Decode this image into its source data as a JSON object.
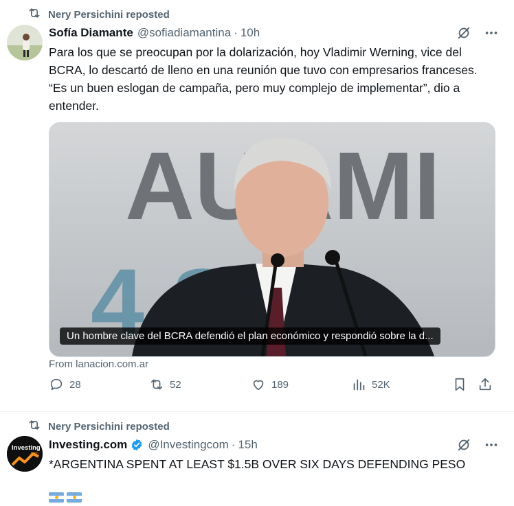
{
  "tweets": [
    {
      "repost_label": "Nery Persichini reposted",
      "name": "Sofía Diamante",
      "handle": "@sofiadiamantina",
      "separator": "·",
      "time": "10h",
      "text": "Para los que se preocupan por la dolarización, hoy Vladimir Werning, vice del BCRA, lo descartó de lleno en una reunión que tuvo con empresarios franceses. “Es un buen eslogan de campaña, pero muy complejo de implementar”, dio a entender.",
      "card": {
        "background_text_top": "AUAMI",
        "background_text_bottom": "4  S",
        "caption": "Un hombre clave del BCRA defendió el plan económico y respondió sobre la d...",
        "source": "From lanacion.com.ar"
      },
      "stats": {
        "replies": "28",
        "reposts": "52",
        "likes": "189",
        "views": "52K"
      }
    },
    {
      "repost_label": "Nery Persichini reposted",
      "name": "Investing.com",
      "handle": "@Investingcom",
      "separator": "·",
      "time": "15h",
      "text": "*ARGENTINA SPENT AT LEAST $1.5B OVER SIX DAYS DEFENDING PESO",
      "avatar_text": "Investing",
      "avatar_subtext": ".com"
    }
  ],
  "colors": {
    "text": "#0f1419",
    "muted": "#536471",
    "verified": "#1d9bf0",
    "divider": "#eff3f4"
  }
}
